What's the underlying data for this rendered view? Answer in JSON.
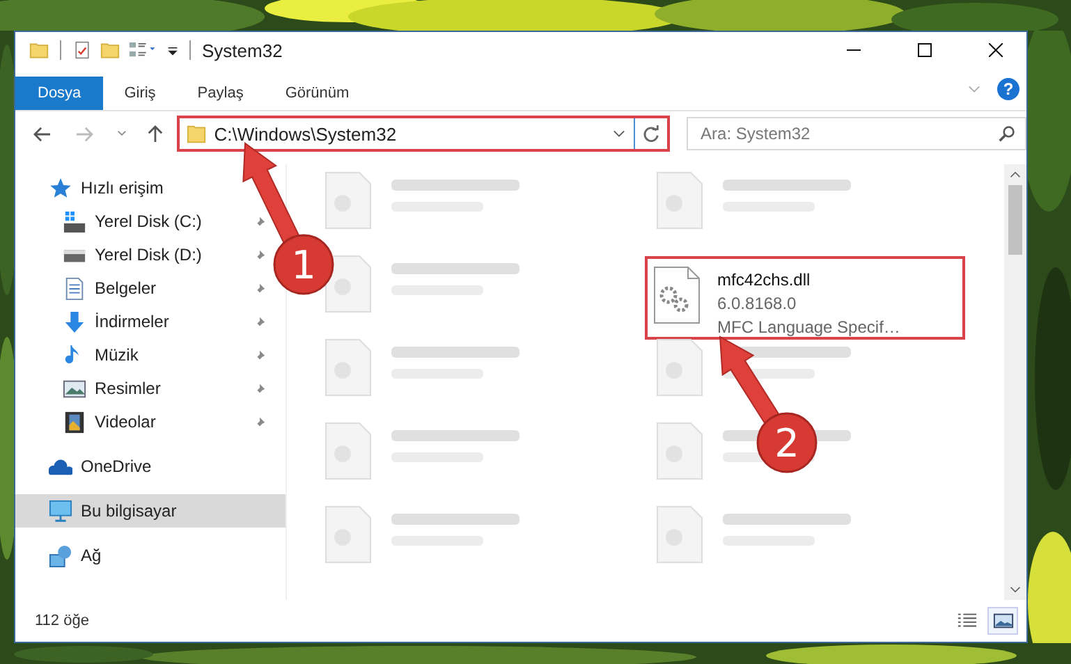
{
  "window": {
    "title": "System32",
    "help": "?"
  },
  "ribbon_tabs": [
    {
      "label": "Dosya",
      "selected": true
    },
    {
      "label": "Giriş",
      "selected": false
    },
    {
      "label": "Paylaş",
      "selected": false
    },
    {
      "label": "Görünüm",
      "selected": false
    }
  ],
  "address": {
    "path": "C:\\Windows\\System32",
    "highlighted": true
  },
  "search": {
    "placeholder": "Ara: System32"
  },
  "sidebar": {
    "items": [
      {
        "label": "Hızlı erişim",
        "kind": "star",
        "selected": false,
        "children": [
          {
            "label": "Yerel Disk (C:)",
            "kind": "system-drive",
            "pinned": true,
            "selected": false
          },
          {
            "label": "Yerel Disk (D:)",
            "kind": "drive",
            "pinned": true,
            "selected": false
          },
          {
            "label": "Belgeler",
            "kind": "documents",
            "pinned": true,
            "selected": false
          },
          {
            "label": "İndirmeler",
            "kind": "downloads",
            "pinned": true,
            "selected": false
          },
          {
            "label": "Müzik",
            "kind": "music",
            "pinned": true,
            "selected": false
          },
          {
            "label": "Resimler",
            "kind": "pictures",
            "pinned": true,
            "selected": false
          },
          {
            "label": "Videolar",
            "kind": "videos",
            "pinned": true,
            "selected": false
          }
        ]
      },
      {
        "label": "OneDrive",
        "kind": "cloud",
        "selected": false
      },
      {
        "label": "Bu bilgisayar",
        "kind": "computer",
        "selected": true
      },
      {
        "label": "Ağ",
        "kind": "network",
        "selected": false
      }
    ]
  },
  "files": [
    {
      "kind": "blurred"
    },
    {
      "kind": "blurred"
    },
    {
      "kind": "blurred"
    },
    {
      "kind": "file",
      "name": "mfc42chs.dll",
      "lines": [
        "6.0.8168.0",
        "MFC Language Specif…"
      ],
      "highlighted": true
    },
    {
      "kind": "blurred"
    },
    {
      "kind": "blurred"
    },
    {
      "kind": "blurred"
    },
    {
      "kind": "blurred"
    },
    {
      "kind": "blurred"
    },
    {
      "kind": "blurred"
    }
  ],
  "status_bar": {
    "count": "112 öğe",
    "views": [
      {
        "kind": "details",
        "selected": false
      },
      {
        "kind": "large-icons",
        "selected": true
      }
    ]
  },
  "annotations": [
    {
      "number": "1"
    },
    {
      "number": "2"
    }
  ]
}
